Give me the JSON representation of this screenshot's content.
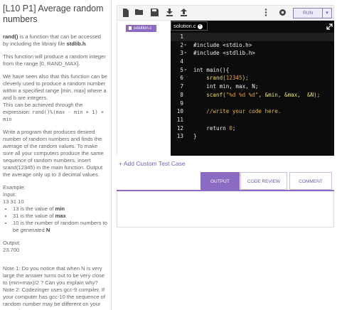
{
  "problem": {
    "title": "[L10 P1] Average random numbers",
    "p1_term": "rand()",
    "p1_mid": " is a function that can be accessed by including the library file ",
    "p1_lib": "stdlib.h",
    "p1_end": ".",
    "p2": "This function will produce a random integer from the range [0, RAND_MAX].",
    "p3_a": "We have seen also that this function can be cleverly used to produce a random number within a specified range [min, max] where a and b are integers.",
    "p3_b": "This can be achieved through the expression: ",
    "p3_expr": "rand()%(max - min + 1) + min",
    "p4": "Write a program that produces desired number of random numbers and finds the average of the random values. To make sure all your computers produce the same sequence of random numbers, insert srand(12345) in the main function. Output the average only up to 3 decimal values.",
    "example_label": "Example:",
    "input_label": "Input:",
    "input_value": "13 31 10",
    "bullets": [
      {
        "pre": "13 is the value of ",
        "bold": "min"
      },
      {
        "pre": "31 is the value of ",
        "bold": "max"
      },
      {
        "pre": "10 is the number of random numbers to be generated ",
        "bold": "N"
      }
    ],
    "output_label": "Output:",
    "output_value": "23.700",
    "note1": "Note 1: Do you notice that when N is very large the answer turns out to be very close to (min+max)/2 ? Can you explain why?",
    "note2": "Note 2: Codezinger uses gcc-9 compiler. If your computer has gcc-10 the sequence of random number may be different on your computer."
  },
  "toolbar": {
    "icons": [
      "file-icon",
      "folder-open-icon",
      "save-icon",
      "download-icon",
      "upload-icon",
      "more-vert-icon",
      "settings-icon"
    ],
    "run_label": "RUN"
  },
  "files": {
    "active": "solution.c"
  },
  "editor": {
    "tab_name": "solution.c",
    "lines": [
      {
        "n": "1",
        "fold": "",
        "parts": []
      },
      {
        "n": "2",
        "fold": "▾",
        "parts": [
          {
            "t": "#include <stdio.h>",
            "c": "w"
          }
        ]
      },
      {
        "n": "3",
        "fold": "▾",
        "parts": [
          {
            "t": "#include <stdlib.h>",
            "c": "w"
          }
        ]
      },
      {
        "n": "4",
        "fold": "",
        "parts": []
      },
      {
        "n": "5",
        "fold": "▾",
        "parts": [
          {
            "t": "int main(){",
            "c": "w"
          }
        ]
      },
      {
        "n": "6",
        "fold": "",
        "parts": [
          {
            "t": "    srand(",
            "c": "y"
          },
          {
            "t": "12345",
            "c": "o"
          },
          {
            "t": ");",
            "c": "y"
          }
        ]
      },
      {
        "n": "7",
        "fold": "",
        "parts": [
          {
            "t": "    int min, max, N;",
            "c": "w"
          }
        ]
      },
      {
        "n": "8",
        "fold": "",
        "parts": [
          {
            "t": "    scanf(",
            "c": "y"
          },
          {
            "t": "\"%d %d %d\"",
            "c": "o"
          },
          {
            "t": ", &min, &max,  &N);",
            "c": "y"
          }
        ]
      },
      {
        "n": "9",
        "fold": "",
        "parts": []
      },
      {
        "n": "10",
        "fold": "",
        "parts": [
          {
            "t": "    //write your code here.",
            "c": "c"
          }
        ]
      },
      {
        "n": "11",
        "fold": "",
        "parts": []
      },
      {
        "n": "12",
        "fold": "",
        "parts": [
          {
            "t": "    return ",
            "c": "w"
          },
          {
            "t": "0",
            "c": "o"
          },
          {
            "t": ";",
            "c": "w"
          }
        ]
      },
      {
        "n": "13",
        "fold": "",
        "parts": [
          {
            "t": "}",
            "c": "w"
          }
        ]
      }
    ]
  },
  "tests": {
    "add_label": "+ Add Custom Test Case"
  },
  "result_tabs": {
    "output": "OUTPUT",
    "review": "CODE REVIEW",
    "comment": "COMMENT"
  },
  "colors": {
    "accent": "#8a6bc1",
    "editor_bg": "#0c0c0c"
  }
}
